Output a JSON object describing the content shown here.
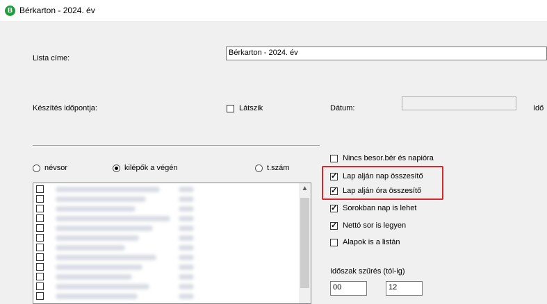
{
  "window": {
    "title": "Bérkarton - 2024. év",
    "icon_letter": "B"
  },
  "form": {
    "list_title_label": "Lista címe:",
    "list_title_value": "Bérkarton - 2024. év",
    "created_label": "Készítés időpontja:",
    "visible_label": "Látszik",
    "date_label": "Dátum:",
    "date_value": "",
    "time_label_partial": "Idő"
  },
  "sort": {
    "options": [
      "névsor",
      "kilépők a végén",
      "t.szám"
    ],
    "selected": "kilépők a végén"
  },
  "options": [
    {
      "label": "Nincs besor.bér és napióra",
      "checked": false
    },
    {
      "label": "Lap alján nap összesítő",
      "checked": true
    },
    {
      "label": "Lap alján óra összesítő",
      "checked": true
    },
    {
      "label": "Sorokban nap is lehet",
      "checked": true
    },
    {
      "label": "Nettó sor is legyen",
      "checked": true
    },
    {
      "label": "Alapok is a listán",
      "checked": false
    }
  ],
  "period": {
    "label": "Időszak szűrés (tól-ig)",
    "from": "00",
    "to": "12"
  },
  "employees": {
    "row_count": 12
  },
  "colors": {
    "highlight": "#d9262c",
    "app_icon": "#1e9e3b"
  }
}
